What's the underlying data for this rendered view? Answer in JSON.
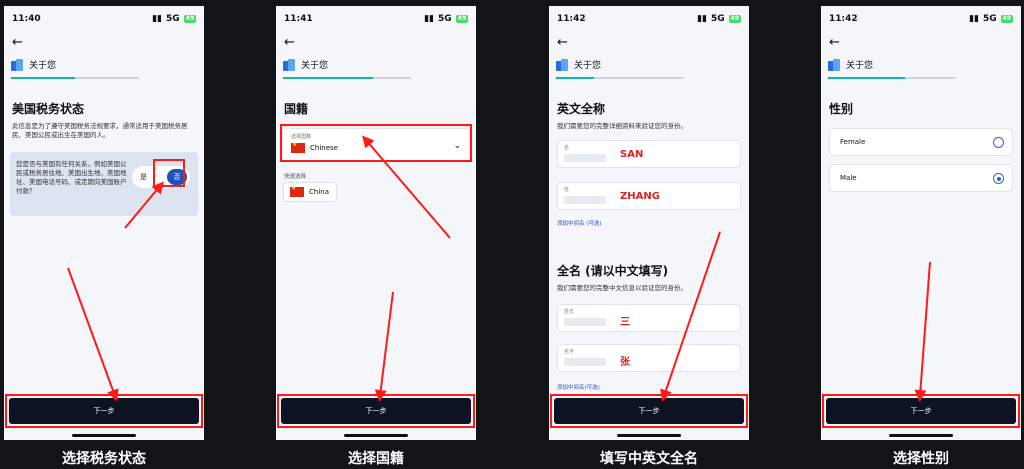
{
  "common": {
    "about_label": "关于您",
    "next_label": "下一步",
    "network": "5G",
    "battery": "49"
  },
  "captions": [
    "选择税务状态",
    "选择国籍",
    "填写中英文全名",
    "选择性别"
  ],
  "screen1": {
    "time": "11:40",
    "progress": 0.5,
    "title": "美国税务状态",
    "desc": "此信息是为了遵守美国税务法规要求，通常适用于美国税务居民、美国公民或出生在美国的人。",
    "question": "您是否与美国有任何关系，例如美国公民或税务居住地、美国出生地、美国地址、美国电话号码、或定期向美国账户付款？",
    "yes_label": "是",
    "no_label": "否"
  },
  "screen2": {
    "time": "11:41",
    "progress": 0.7,
    "title": "国籍",
    "select_label": "选择国籍",
    "select_value": "Chinese",
    "quick_label": "快速选择",
    "quick_chip": "China"
  },
  "screen3": {
    "time": "11:42",
    "progress": 0.3,
    "title_en": "英文全称",
    "desc_en": "我们需要您的完整详细资料来验证您的身份。",
    "first_label": "名",
    "first_value": "SAN",
    "last_label": "姓",
    "last_value": "ZHANG",
    "add_middle_en": "添加中间名 (可选)",
    "title_cn": "全名 (请以中文填写)",
    "desc_cn": "我们需要您的完整中文信息以验证您的身份。",
    "cn_first_label": "姓氏",
    "cn_first_value": "三",
    "cn_last_label": "名字",
    "cn_last_value": "张",
    "add_middle_cn": "添加中间名(可选)"
  },
  "screen4": {
    "time": "11:42",
    "progress": 0.6,
    "title": "性别",
    "options": [
      "Female",
      "Male"
    ],
    "selected": "Male"
  }
}
